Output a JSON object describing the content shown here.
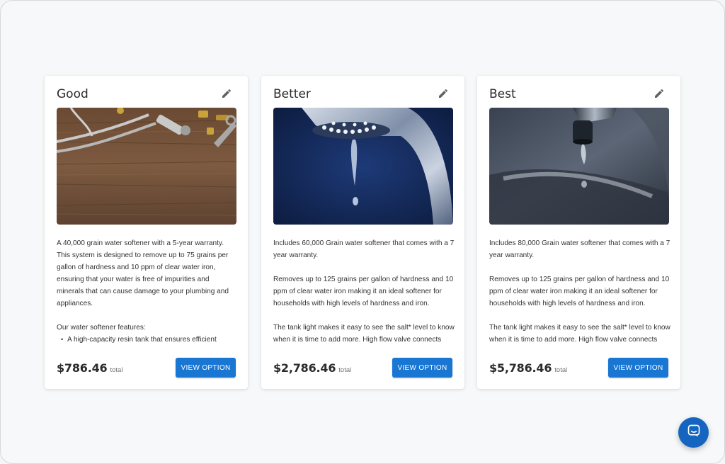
{
  "options": [
    {
      "title": "Good",
      "image_icon": "plumbing-tools-photo",
      "description": {
        "paragraphs": [
          "A 40,000 grain water softener with a 5-year warranty. This system is designed to remove up to 75 grains per gallon of hardness and 10 ppm of clear water iron, ensuring that your water is free of impurities and minerals that can cause damage to your plumbing and appliances.",
          "Our water softener features:"
        ],
        "bullets": [
          "A high-capacity resin tank that ensures efficient operation and longer periods between regeneration..."
        ]
      },
      "price": "$786.46",
      "price_suffix": "total",
      "button_label": "VIEW OPTION"
    },
    {
      "title": "Better",
      "image_icon": "faucet-drip-photo",
      "description": {
        "paragraphs": [
          "Includes 60,000 Grain water softener that comes with a 7 year warranty.",
          "Removes up to 125 grains per gallon of hardness and 10 ppm of clear water iron making it an ideal softener for households with high levels of hardness and iron.",
          "The tank light makes it easy to see the salt* level to know when it is time to add more. High flow valve connects to..."
        ],
        "bullets": []
      },
      "price": "$2,786.46",
      "price_suffix": "total",
      "button_label": "VIEW OPTION"
    },
    {
      "title": "Best",
      "image_icon": "faucet-drip-closeup-photo",
      "description": {
        "paragraphs": [
          "Includes 80,000 Grain water softener that comes with a 7 year warranty.",
          "Removes up to 125 grains per gallon of hardness and 10 ppm of clear water iron making it an ideal softener for households with high levels of hardness and iron.",
          "The tank light makes it easy to see the salt* level to know when it is time to add more. High flow valve connects to..."
        ],
        "bullets": []
      },
      "price": "$5,786.46",
      "price_suffix": "total",
      "button_label": "VIEW OPTION"
    }
  ],
  "icons": {
    "edit": "pencil-icon",
    "chat": "chat-icon"
  },
  "colors": {
    "primary_button": "#1976d2",
    "chat_fab": "#1565c0",
    "card_bg": "#ffffff",
    "page_bg": "#f7f8f9"
  }
}
